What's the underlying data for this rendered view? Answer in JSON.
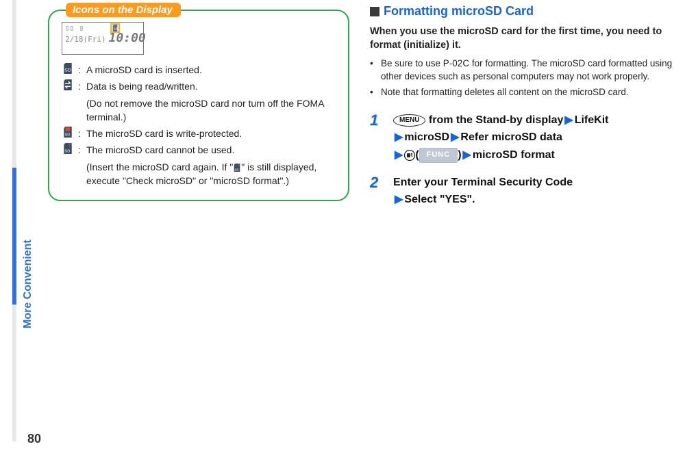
{
  "side": {
    "label": "More Convenient"
  },
  "page_number": "80",
  "callout": {
    "title": "Icons on the Display",
    "screen": {
      "date": "2/18(Fri)",
      "time": "10:00"
    }
  },
  "icon_defs": {
    "sd_inserted": "A microSD card is inserted.",
    "sd_rw": "Data is being read/written.",
    "sd_rw_sub": "(Do not remove the microSD card nor turn off the FOMA terminal.)",
    "sd_locked": "The microSD card is write-protected.",
    "sd_bad": "The microSD card cannot be used.",
    "sd_bad_sub_a": "(Insert the microSD card again. If \"",
    "sd_bad_sub_b": "\" is still displayed, execute \"Check microSD\" or \"microSD format\".)"
  },
  "right": {
    "title": "Formatting microSD Card",
    "intro": "When you use the microSD card for the first time, you need to format (initialize) it.",
    "bullet1": "Be sure to use P-02C for formatting. The microSD card formatted using other devices such as personal computers may not work properly.",
    "bullet2": "Note that formatting deletes all content on the microSD card.",
    "menu_label": "MENU",
    "func_label": "FUNC",
    "step1": {
      "a": "from the Stand-by display",
      "b": "LifeKit",
      "c": "microSD",
      "d": "Refer microSD data",
      "e": "microSD format"
    },
    "step2": {
      "a": "Enter your Terminal Security Code",
      "b": "Select \"YES\"."
    }
  }
}
